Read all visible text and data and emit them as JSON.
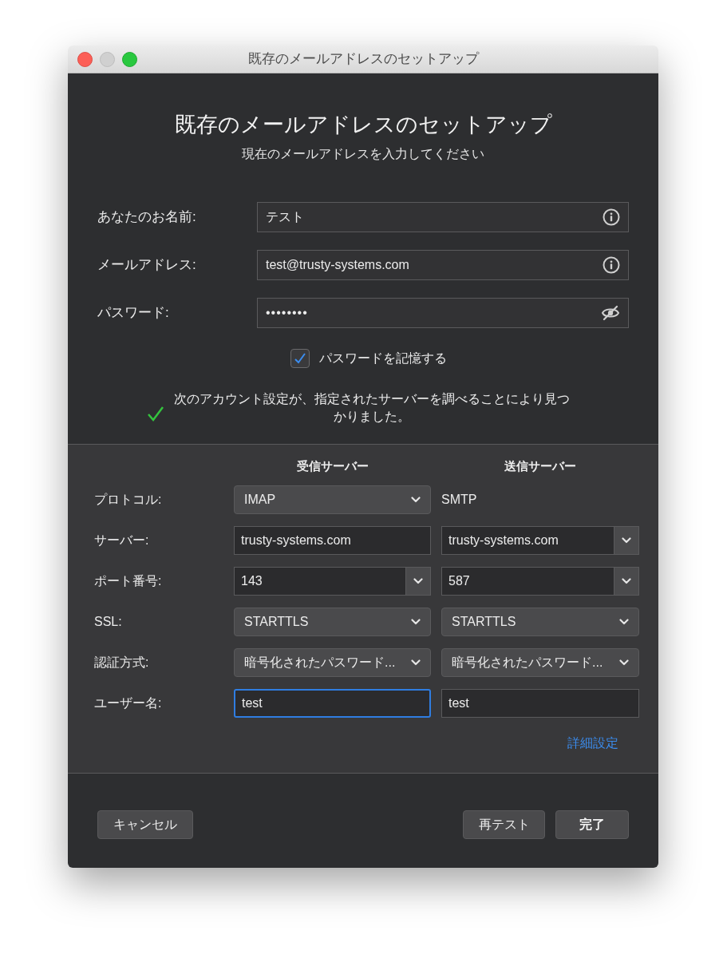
{
  "window": {
    "title": "既存のメールアドレスのセットアップ"
  },
  "header": {
    "title": "既存のメールアドレスのセットアップ",
    "subtitle": "現在のメールアドレスを入力してください"
  },
  "identity_fields": [
    {
      "label": "あなたのお名前:",
      "value": "テスト",
      "kind": "info"
    },
    {
      "label": "メールアドレス:",
      "value": "test@trusty-systems.com",
      "kind": "info"
    },
    {
      "label": "パスワード:",
      "value": "••••••••",
      "kind": "password"
    }
  ],
  "remember_password": {
    "label": "パスワードを記憶する",
    "checked": true
  },
  "status_message": {
    "text": "次のアカウント設定が、指定されたサーバーを調べることにより見つかりました。",
    "success": true
  },
  "server_settings": {
    "columns": [
      "受信サーバー",
      "送信サーバー"
    ],
    "rows": [
      {
        "label": "プロトコル:",
        "cells": [
          {
            "kind": "select",
            "value": "IMAP"
          },
          {
            "kind": "text",
            "value": "SMTP"
          }
        ]
      },
      {
        "label": "サーバー:",
        "cells": [
          {
            "kind": "field",
            "value": "trusty-systems.com",
            "focused": false
          },
          {
            "kind": "combo",
            "value": "trusty-systems.com"
          }
        ]
      },
      {
        "label": "ポート番号:",
        "cells": [
          {
            "kind": "combo",
            "value": "143"
          },
          {
            "kind": "combo",
            "value": "587"
          }
        ]
      },
      {
        "label": "SSL:",
        "cells": [
          {
            "kind": "select",
            "value": "STARTTLS"
          },
          {
            "kind": "select",
            "value": "STARTTLS"
          }
        ]
      },
      {
        "label": "認証方式:",
        "cells": [
          {
            "kind": "select",
            "value": "暗号化されたパスワード..."
          },
          {
            "kind": "select",
            "value": "暗号化されたパスワード..."
          }
        ]
      },
      {
        "label": "ユーザー名:",
        "cells": [
          {
            "kind": "field",
            "value": "test",
            "focused": true
          },
          {
            "kind": "field",
            "value": "test",
            "focused": false
          }
        ]
      }
    ],
    "advanced_link": "詳細設定"
  },
  "buttons": {
    "cancel": "キャンセル",
    "retest": "再テスト",
    "done": "完了"
  }
}
